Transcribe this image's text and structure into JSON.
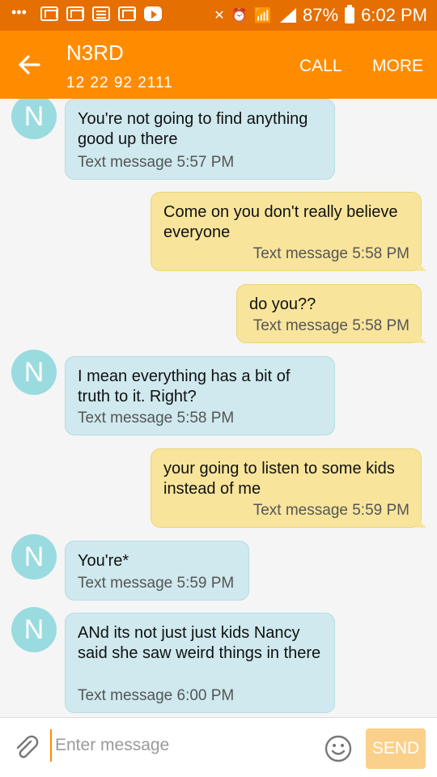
{
  "status_bar": {
    "battery": "87%",
    "time": "6:02 PM",
    "icons": [
      "more-icon",
      "mail-icon",
      "mail-icon",
      "document-icon",
      "mail-icon",
      "youtube-icon",
      "mute-icon",
      "alarm-icon",
      "wifi-icon",
      "signal-icon",
      "battery-icon"
    ]
  },
  "header": {
    "contact_name": "N3RD",
    "contact_number": "12 22 92 2111",
    "call_label": "CALL",
    "more_label": "MORE",
    "accent_color": "#ff8c00"
  },
  "messages": [
    {
      "direction": "incoming",
      "avatar": "N",
      "text": "You're not going to find anything good up there",
      "meta": "Text message 5:57 PM"
    },
    {
      "direction": "outgoing",
      "text": "Come on you don't really believe everyone",
      "meta": "Text message 5:58 PM"
    },
    {
      "direction": "outgoing",
      "text": "do you??",
      "meta": "Text message 5:58 PM"
    },
    {
      "direction": "incoming",
      "avatar": "N",
      "text": "I mean everything has a bit of truth to it. Right?",
      "meta": "Text message 5:58 PM"
    },
    {
      "direction": "outgoing",
      "text": "your going to listen to some kids instead of me",
      "meta": "Text message 5:59 PM"
    },
    {
      "direction": "incoming",
      "avatar": "N",
      "text": "You're*",
      "meta": "Text message 5:59 PM"
    },
    {
      "direction": "incoming",
      "avatar": "N",
      "text": "ANd its not just just kids Nancy said she saw weird things in there",
      "meta": "Text message 6:00 PM"
    }
  ],
  "composer": {
    "placeholder": "Enter message",
    "value": "",
    "send_label": "SEND"
  }
}
